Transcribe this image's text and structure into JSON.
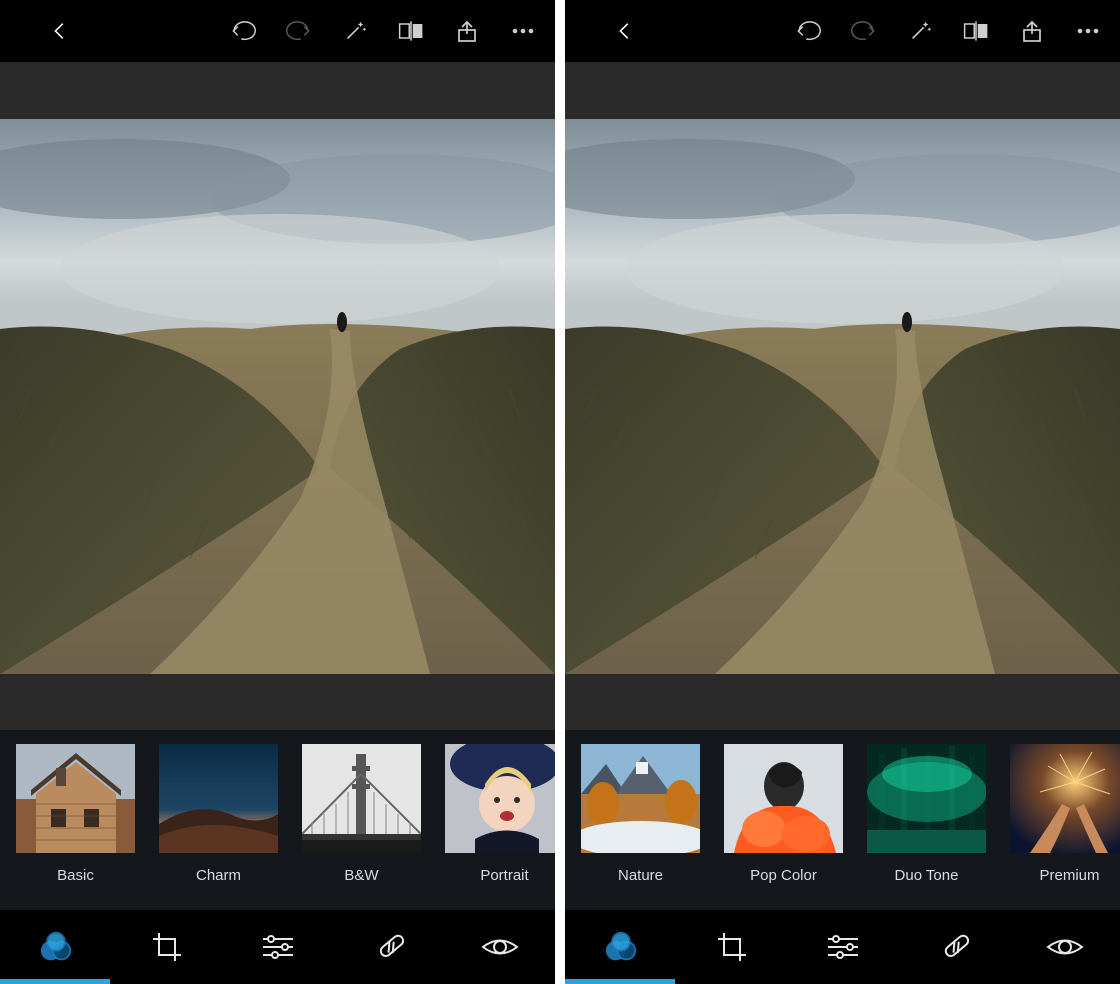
{
  "screens": [
    {
      "topbar_icons": [
        "back",
        "undo",
        "redo",
        "auto-enhance",
        "compare",
        "share",
        "more"
      ],
      "filters": [
        {
          "label": "Basic",
          "thumb": "basic"
        },
        {
          "label": "Charm",
          "thumb": "charm"
        },
        {
          "label": "B&W",
          "thumb": "bw"
        },
        {
          "label": "Portrait",
          "thumb": "portrait"
        }
      ],
      "bottom_tools": [
        "looks",
        "crop",
        "adjust",
        "heal",
        "redeye"
      ],
      "bottom_active_index": 0
    },
    {
      "topbar_icons": [
        "back",
        "undo",
        "redo",
        "auto-enhance",
        "compare",
        "share",
        "more"
      ],
      "filters": [
        {
          "label": "Nature",
          "thumb": "nature"
        },
        {
          "label": "Pop Color",
          "thumb": "popcolor"
        },
        {
          "label": "Duo Tone",
          "thumb": "duotone"
        },
        {
          "label": "Premium",
          "thumb": "premium"
        }
      ],
      "bottom_tools": [
        "looks",
        "crop",
        "adjust",
        "heal",
        "redeye"
      ],
      "bottom_active_index": 0
    }
  ]
}
